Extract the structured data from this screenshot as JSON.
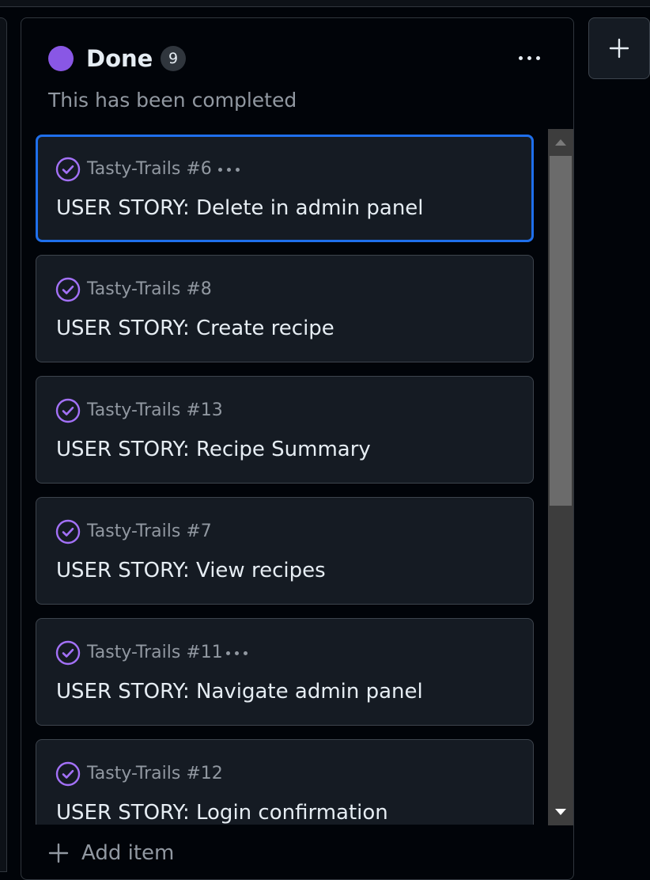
{
  "column": {
    "title": "Done",
    "count": "9",
    "description": "This has been completed",
    "color": "#8957e5"
  },
  "cards": [
    {
      "ref": "Tasty-Trails #6",
      "title": "USER STORY: Delete in admin panel",
      "status_icon": "check-circle-icon",
      "selected": true,
      "menu_visible": true
    },
    {
      "ref": "Tasty-Trails #8",
      "title": "USER STORY: Create recipe",
      "status_icon": "check-circle-icon",
      "selected": false,
      "menu_visible": false
    },
    {
      "ref": "Tasty-Trails #13",
      "title": "USER STORY: Recipe Summary",
      "status_icon": "check-circle-icon",
      "selected": false,
      "menu_visible": false
    },
    {
      "ref": "Tasty-Trails #7",
      "title": "USER STORY: View recipes",
      "status_icon": "check-circle-icon",
      "selected": false,
      "menu_visible": false
    },
    {
      "ref": "Tasty-Trails #11",
      "title": "USER STORY: Navigate admin panel",
      "status_icon": "check-circle-icon",
      "selected": false,
      "menu_visible": true
    },
    {
      "ref": "Tasty-Trails #12",
      "title": "USER STORY: Login confirmation",
      "status_icon": "check-circle-icon",
      "selected": false,
      "menu_visible": false
    }
  ],
  "footer": {
    "add_item_label": "Add item"
  },
  "icons": {
    "column_menu": "kebab-horizontal-icon",
    "add_column": "plus-icon",
    "add_item": "plus-icon"
  },
  "colors": {
    "done_purple": "#8957e5",
    "done_icon": "#a371f7",
    "selection_blue": "#1f6feb"
  }
}
